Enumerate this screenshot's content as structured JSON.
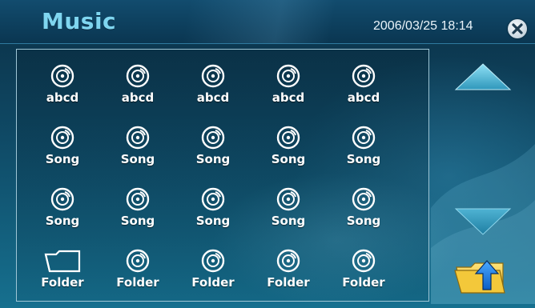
{
  "header": {
    "title": "Music",
    "datetime": "2006/03/25 18:14"
  },
  "grid": {
    "rows": [
      [
        "abcd",
        "abcd",
        "abcd",
        "abcd",
        "abcd"
      ],
      [
        "Song",
        "Song",
        "Song",
        "Song",
        "Song"
      ],
      [
        "Song",
        "Song",
        "Song",
        "Song",
        "Song"
      ],
      [
        "Folder",
        "Folder",
        "Folder",
        "Folder",
        "Folder"
      ]
    ],
    "icons": [
      [
        "disc-icon",
        "disc-icon",
        "disc-icon",
        "disc-icon",
        "disc-icon"
      ],
      [
        "disc-icon",
        "disc-icon",
        "disc-icon",
        "disc-icon",
        "disc-icon"
      ],
      [
        "disc-icon",
        "disc-icon",
        "disc-icon",
        "disc-icon",
        "disc-icon"
      ],
      [
        "folder-icon",
        "disc-icon",
        "disc-icon",
        "disc-icon",
        "disc-icon"
      ]
    ]
  },
  "icons": {
    "close": "close-icon",
    "scroll_up": "arrow-up-icon",
    "scroll_down": "arrow-down-icon",
    "parent_folder": "folder-up-icon"
  },
  "colors": {
    "accent": "#7fd6f0",
    "arrow": "#57b9d6",
    "folder": "#f2cc3a",
    "background": "#0f4a66"
  }
}
